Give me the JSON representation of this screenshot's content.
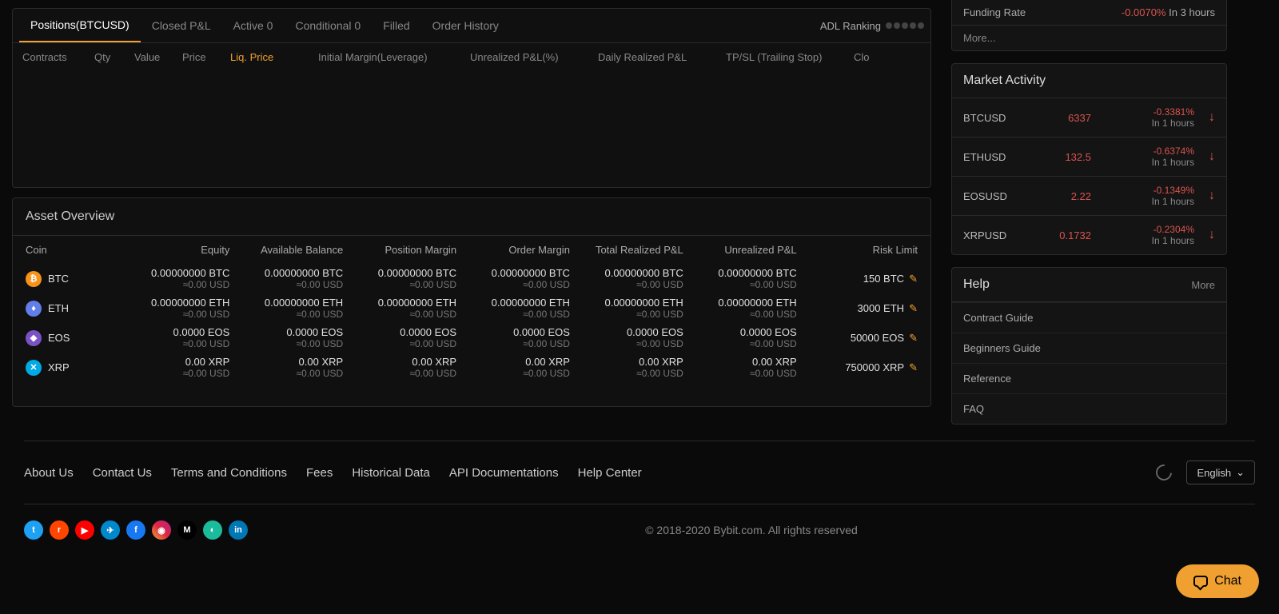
{
  "tabs": {
    "positions": "Positions(BTCUSD)",
    "closed": "Closed P&L",
    "active": "Active 0",
    "conditional": "Conditional 0",
    "filled": "Filled",
    "history": "Order History"
  },
  "adl_label": "ADL Ranking",
  "pos_headers": {
    "contracts": "Contracts",
    "qty": "Qty",
    "value": "Value",
    "price": "Price",
    "liq": "Liq. Price",
    "initial": "Initial Margin(Leverage)",
    "unrealized": "Unrealized P&L(%)",
    "daily": "Daily Realized P&L",
    "tpsl": "TP/SL (Trailing Stop)",
    "close": "Clo"
  },
  "asset_title": "Asset Overview",
  "asset_headers": {
    "coin": "Coin",
    "equity": "Equity",
    "available": "Available Balance",
    "position": "Position Margin",
    "order": "Order Margin",
    "total": "Total Realized P&L",
    "unrealized": "Unrealized P&L",
    "risk": "Risk Limit"
  },
  "assets": [
    {
      "sym": "BTC",
      "icon": "₿",
      "cls": "btc-ic",
      "v1": "0.00000000  BTC",
      "u": "≈0.00  USD",
      "risk": "150 BTC"
    },
    {
      "sym": "ETH",
      "icon": "♦",
      "cls": "eth-ic",
      "v1": "0.00000000  ETH",
      "u": "≈0.00  USD",
      "risk": "3000 ETH"
    },
    {
      "sym": "EOS",
      "icon": "◆",
      "cls": "eos-ic",
      "v1": "0.0000  EOS",
      "u": "≈0.00  USD",
      "risk": "50000 EOS"
    },
    {
      "sym": "XRP",
      "icon": "✕",
      "cls": "xrp-ic",
      "v1": "0.00  XRP",
      "u": "≈0.00  USD",
      "risk": "750000 XRP"
    }
  ],
  "funding": {
    "label": "Funding Rate",
    "val": "-0.0070%",
    "time": "In 3 hours"
  },
  "more": "More...",
  "market_title": "Market Activity",
  "markets": [
    {
      "sym": "BTCUSD",
      "price": "6337",
      "chg": "-0.3381%",
      "time": "In 1 hours"
    },
    {
      "sym": "ETHUSD",
      "price": "132.5",
      "chg": "-0.6374%",
      "time": "In 1 hours"
    },
    {
      "sym": "EOSUSD",
      "price": "2.22",
      "chg": "-0.1349%",
      "time": "In 1 hours"
    },
    {
      "sym": "XRPUSD",
      "price": "0.1732",
      "chg": "-0.2304%",
      "time": "In 1 hours"
    }
  ],
  "help_title": "Help",
  "help_more": "More",
  "help_items": [
    "Contract Guide",
    "Beginners Guide",
    "Reference",
    "FAQ"
  ],
  "footer_links": [
    "About Us",
    "Contact Us",
    "Terms and Conditions",
    "Fees",
    "Historical Data",
    "API Documentations",
    "Help Center"
  ],
  "lang": "English",
  "socials": [
    {
      "bg": "#1da1f2",
      "t": "t"
    },
    {
      "bg": "#ff4500",
      "t": "r"
    },
    {
      "bg": "#ff0000",
      "t": "▶"
    },
    {
      "bg": "#0088cc",
      "t": "✈"
    },
    {
      "bg": "#1877f2",
      "t": "f"
    },
    {
      "bg": "linear-gradient(45deg,#f09433,#e6683c,#dc2743,#cc2366,#bc1888)",
      "t": "◉"
    },
    {
      "bg": "#000",
      "t": "M"
    },
    {
      "bg": "#1abc9c",
      "t": "◐"
    },
    {
      "bg": "#0077b5",
      "t": "in"
    }
  ],
  "copyright": "© 2018-2020 Bybit.com. All rights reserved",
  "chat": "Chat"
}
